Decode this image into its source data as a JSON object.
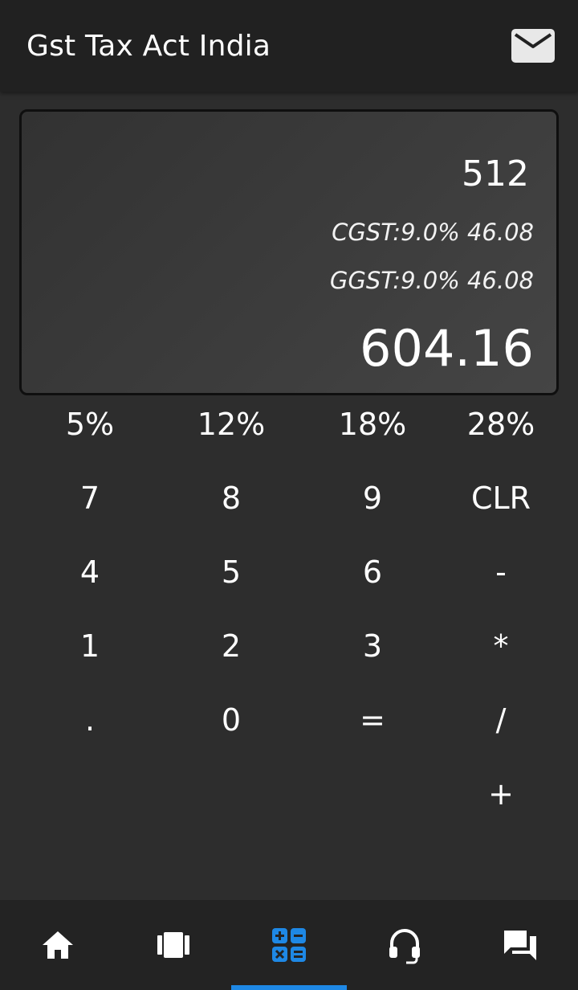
{
  "app_bar": {
    "title": "Gst Tax Act India",
    "mail_icon": "mail-icon"
  },
  "display": {
    "input": "512",
    "cgst_line": "CGST:9.0% 46.08",
    "sgst_line": "GGST:9.0% 46.08",
    "total": "604.16"
  },
  "keypad": {
    "rates": [
      "5%",
      "12%",
      "18%",
      "28%"
    ],
    "row1": [
      "7",
      "8",
      "9",
      "CLR"
    ],
    "row2": [
      "4",
      "5",
      "6",
      "-"
    ],
    "row3": [
      "1",
      "2",
      "3",
      "*"
    ],
    "row4": [
      ".",
      "0",
      "=",
      "/"
    ],
    "plus": "+"
  },
  "bottom_nav": {
    "items": [
      {
        "icon": "home-icon"
      },
      {
        "icon": "carousel-icon"
      },
      {
        "icon": "calculator-icon"
      },
      {
        "icon": "headset-icon"
      },
      {
        "icon": "chat-icon"
      }
    ],
    "active_index": 2,
    "accent_color": "#1e88e5"
  }
}
